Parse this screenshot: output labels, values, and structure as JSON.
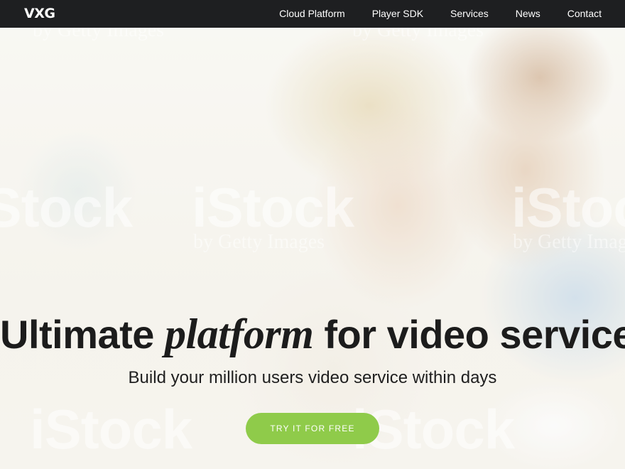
{
  "header": {
    "logo_text": "VXG",
    "nav": [
      {
        "label": "Cloud Platform"
      },
      {
        "label": "Player SDK"
      },
      {
        "label": "Services"
      },
      {
        "label": "News"
      },
      {
        "label": "Contact"
      }
    ]
  },
  "hero": {
    "headline_start": "Ultimate ",
    "headline_emphasis": "platform",
    "headline_end": " for video services",
    "subheadline": "Build your million users video service within days",
    "cta_label": "TRY IT FOR FREE",
    "background_image": "couple looking at tablet",
    "watermark": {
      "brand": "iStock",
      "byline": "by Getty Images"
    }
  },
  "colors": {
    "topbar": "#1e1f21",
    "cta": "#8fcb4a",
    "headline": "#1c1c1c"
  }
}
